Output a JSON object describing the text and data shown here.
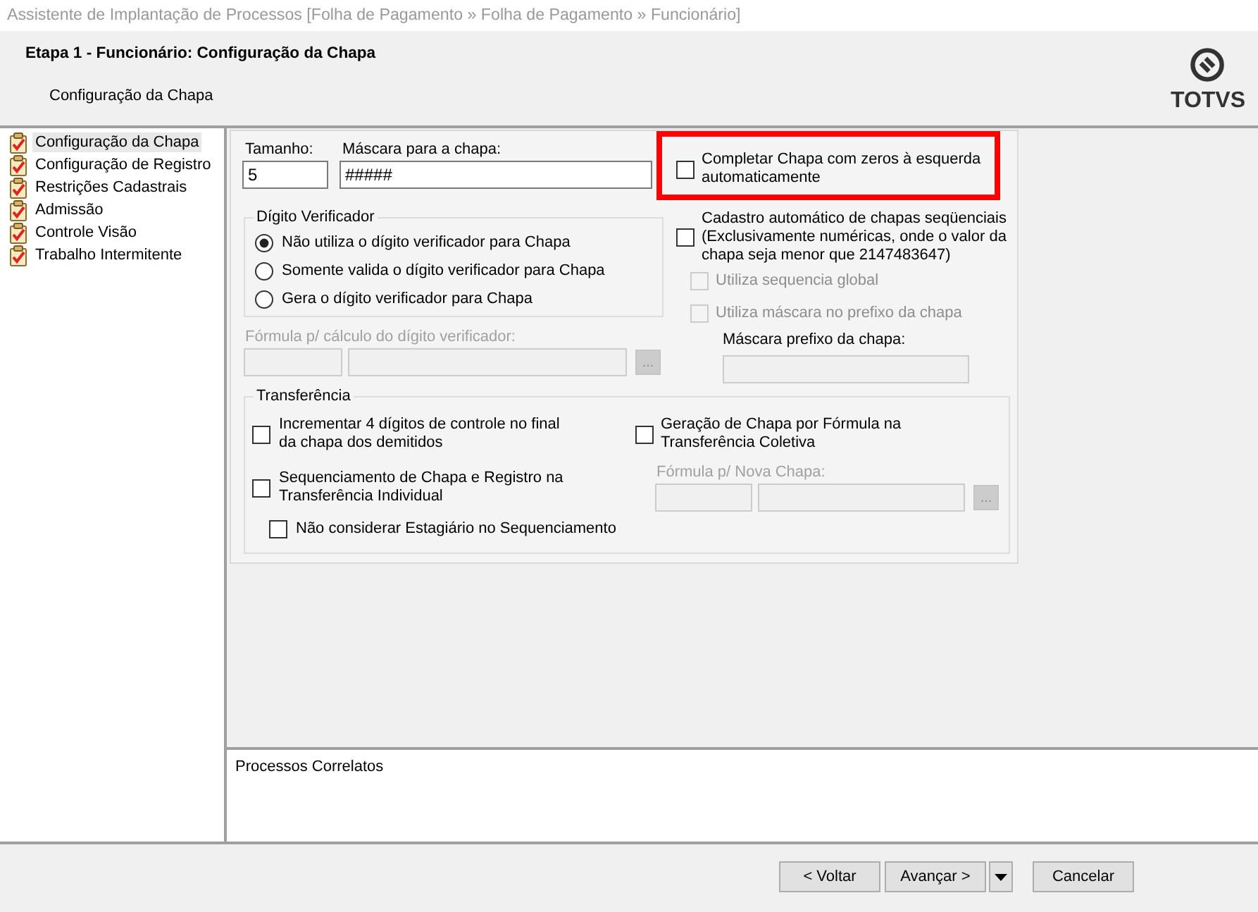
{
  "window": {
    "title": "Assistente de Implantação de Processos [Folha de Pagamento » Folha de Pagamento » Funcionário]"
  },
  "header": {
    "title": "Etapa 1 - Funcionário: Configuração da Chapa",
    "subtitle": "Configuração da Chapa",
    "logo_text": "TOTVS"
  },
  "sidebar": {
    "items": [
      {
        "label": "Configuração da Chapa",
        "selected": true
      },
      {
        "label": "Configuração de Registro",
        "selected": false
      },
      {
        "label": "Restrições Cadastrais",
        "selected": false
      },
      {
        "label": "Admissão",
        "selected": false
      },
      {
        "label": "Controle Visão",
        "selected": false
      },
      {
        "label": "Trabalho Intermitente",
        "selected": false
      }
    ]
  },
  "form": {
    "size_field": {
      "label": "Tamanho:",
      "value": "5"
    },
    "mask_field": {
      "label": "Máscara para a chapa:",
      "value": "#####"
    },
    "check_digit": {
      "title": "Dígito Verificador",
      "options": [
        {
          "label": "Não utiliza o dígito verificador para Chapa",
          "selected": true
        },
        {
          "label": "Somente valida o dígito verificador para Chapa",
          "selected": false
        },
        {
          "label": "Gera o dígito verificador para Chapa",
          "selected": false
        }
      ]
    },
    "digit_formula": {
      "label": "Fórmula p/ cálculo do dígito verificador:",
      "disabled": true,
      "button_label": "..."
    },
    "options": [
      {
        "kind": "checkbox",
        "label": "Completar Chapa com zeros à esquerda\nautomaticamente",
        "checked": false,
        "disabled": false,
        "highlighted": true
      },
      {
        "kind": "checkbox",
        "label": "Cadastro automático de chapas seqüenciais\n(Exclusivamente numéricas, onde o valor da\nchapa seja menor que 2147483647)",
        "checked": false,
        "disabled": false,
        "highlighted": false,
        "children": [
          {
            "kind": "checkbox",
            "label": "Utiliza sequencia global",
            "checked": false,
            "disabled": true
          },
          {
            "kind": "checkbox",
            "label": "Utiliza máscara no prefixo da chapa",
            "checked": false,
            "disabled": true
          },
          {
            "kind": "field",
            "label": "Máscara prefixo da chapa:",
            "disabled": true
          }
        ]
      }
    ],
    "transfer": {
      "title": "Transferência",
      "left": [
        {
          "kind": "checkbox",
          "label": "Incrementar 4 dígitos de controle no final\nda chapa dos demitidos",
          "checked": false,
          "disabled": false
        },
        {
          "kind": "checkbox",
          "label": "Sequenciamento de Chapa e Registro na\nTransferência Individual",
          "checked": false,
          "disabled": false,
          "children": [
            {
              "kind": "checkbox",
              "label": "Não considerar Estagiário no Sequenciamento",
              "checked": false,
              "disabled": false
            }
          ]
        }
      ],
      "right": [
        {
          "kind": "checkbox",
          "label": "Geração de Chapa por Fórmula na\nTransferência Coletiva",
          "checked": false,
          "disabled": false,
          "children": [
            {
              "kind": "formula",
              "label": "Fórmula p/ Nova Chapa:",
              "disabled": true,
              "button_label": "..."
            }
          ]
        }
      ]
    }
  },
  "related": {
    "title": "Processos Correlatos"
  },
  "buttons": [
    {
      "kind": "text",
      "label": "< Voltar"
    },
    {
      "kind": "text",
      "label": "Avançar >"
    },
    {
      "kind": "dropdown"
    },
    {
      "kind": "text",
      "label": "Cancelar"
    }
  ]
}
